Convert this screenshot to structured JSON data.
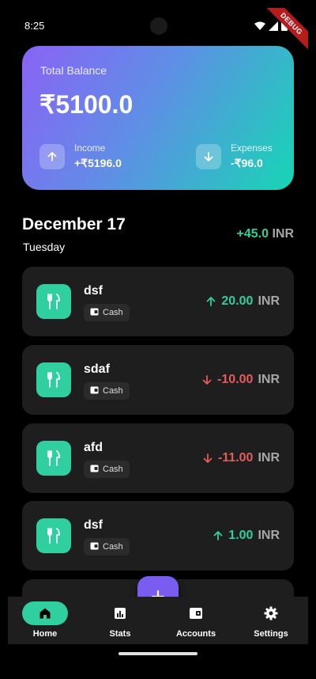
{
  "status_bar": {
    "time": "8:25",
    "debug_label": "DEBUG"
  },
  "balance": {
    "label": "Total Balance",
    "value": "₹5100.0",
    "income_label": "Income",
    "income_value": "+₹5196.0",
    "expense_label": "Expenses",
    "expense_value": "-₹96.0"
  },
  "day": {
    "title": "December 17",
    "weekday": "Tuesday",
    "total": "+45.0",
    "currency": "INR"
  },
  "transactions": [
    {
      "title": "dsf",
      "account": "Cash",
      "amount": "20.00",
      "currency": "INR",
      "direction": "up"
    },
    {
      "title": "sdaf",
      "account": "Cash",
      "amount": "-10.00",
      "currency": "INR",
      "direction": "down"
    },
    {
      "title": "afd",
      "account": "Cash",
      "amount": "-11.00",
      "currency": "INR",
      "direction": "down"
    },
    {
      "title": "dsf",
      "account": "Cash",
      "amount": "1.00",
      "currency": "INR",
      "direction": "up"
    }
  ],
  "nav": {
    "items": [
      {
        "label": "Home",
        "icon": "home-icon"
      },
      {
        "label": "Stats",
        "icon": "stats-icon"
      },
      {
        "label": "Accounts",
        "icon": "wallet-icon"
      },
      {
        "label": "Settings",
        "icon": "gear-icon"
      }
    ],
    "fab_icon": "plus-icon"
  },
  "colors": {
    "accent_green": "#2fcf9f",
    "accent_red": "#e55b5b",
    "accent_purple": "#7b5cf0"
  }
}
